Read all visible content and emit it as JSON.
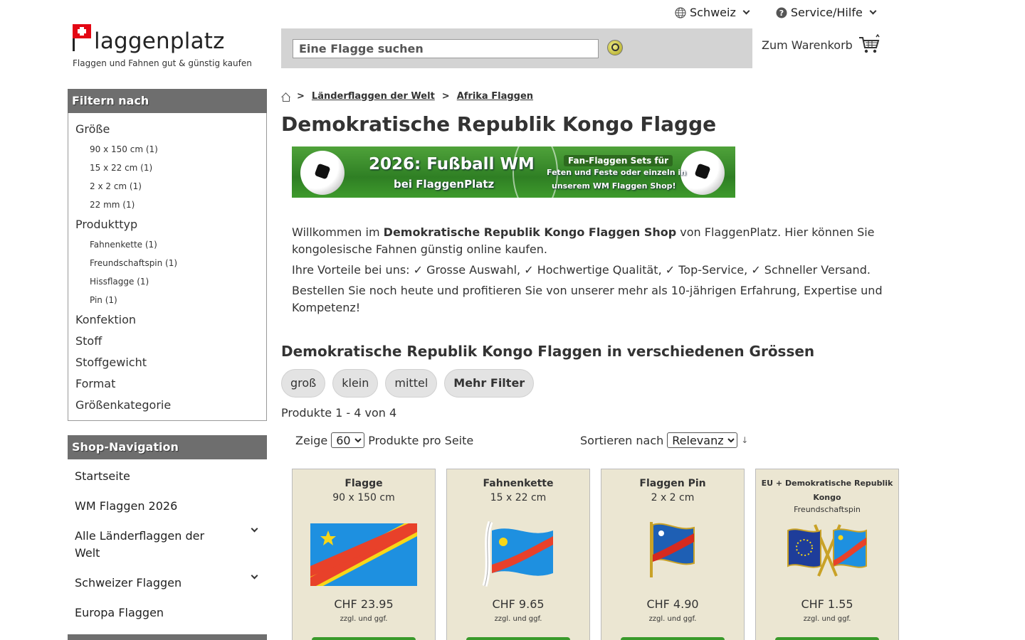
{
  "topbar": {
    "country_label": "Schweiz",
    "service_label": "Service/Hilfe"
  },
  "logo": {
    "name": "laggenplatz",
    "tagline": "Flaggen und Fahnen gut & günstig kaufen"
  },
  "search": {
    "placeholder": "Eine Flagge suchen"
  },
  "cart": {
    "label": "Zum Warenkorb"
  },
  "filter": {
    "heading": "Filtern nach",
    "groups": [
      {
        "label": "Größe",
        "options": [
          "90 x 150 cm (1)",
          "15 x 22 cm (1)",
          "2 x 2 cm (1)",
          "22 mm (1)"
        ]
      },
      {
        "label": "Produkttyp",
        "options": [
          "Fahnenkette (1)",
          "Freundschaftspin (1)",
          "Hissflagge (1)",
          "Pin (1)"
        ]
      },
      {
        "label": "Konfektion"
      },
      {
        "label": "Stoff"
      },
      {
        "label": "Stoffgewicht"
      },
      {
        "label": "Format"
      },
      {
        "label": "Größenkategorie"
      }
    ]
  },
  "shopnav": {
    "heading": "Shop-Navigation",
    "items": [
      {
        "label": "Startseite"
      },
      {
        "label": "WM Flaggen 2026"
      },
      {
        "label": "Alle Länderflaggen der Welt"
      },
      {
        "label": "Schweizer Flaggen"
      },
      {
        "label": "Europa Flaggen"
      }
    ]
  },
  "breadcrumb": {
    "items": [
      "Länderflaggen der Welt",
      "Afrika Flaggen"
    ]
  },
  "page": {
    "title": "Demokratische Republik Kongo Flagge"
  },
  "banner": {
    "headline": "2026: Fußball WM",
    "subline": "bei FlaggenPlatz",
    "tag": "Fan-Flaggen Sets für",
    "line2": "Feten und Feste oder einzeln in",
    "line3": "unserem WM Flaggen Shop!"
  },
  "intro": {
    "p1_pre": "Willkommen im ",
    "p1_bold": "Demokratische Republik Kongo Flaggen Shop",
    "p1_post": " von FlaggenPlatz. Hier können Sie kongolesische Fahnen günstig online kaufen.",
    "p2": "Ihre Vorteile bei uns: ✓ Grosse Auswahl, ✓ Hochwertige Qualität, ✓ Top-Service, ✓ Schneller Versand.",
    "p3": "Bestellen Sie noch heute und profitieren Sie von unserer mehr als 10-jährigen Erfahrung, Expertise und Kompetenz!"
  },
  "listing": {
    "section_title": "Demokratische Republik Kongo Flaggen in verschiedenen Grössen",
    "chips": [
      "groß",
      "klein",
      "mittel",
      "Mehr Filter"
    ],
    "count_text": "Produkte 1 - 4 von 4",
    "show_label": "Zeige",
    "per_page_value": "60",
    "per_page_label": "Produkte pro Seite",
    "sort_label": "Sortieren nach",
    "sort_value": "Relevanz",
    "sort_arrow": "↓"
  },
  "products": [
    {
      "type": "Flagge",
      "size": "90 x 150 cm",
      "price": "CHF 23.95",
      "note": "zzgl. und ggf.",
      "kind": "flag"
    },
    {
      "type": "Fahnenkette",
      "size": "15 x 22 cm",
      "price": "CHF 9.65",
      "note": "zzgl. und ggf.",
      "kind": "chain"
    },
    {
      "type": "Flaggen Pin",
      "size": "2 x 2 cm",
      "price": "CHF 4.90",
      "note": "zzgl. und ggf.",
      "kind": "pin"
    },
    {
      "type": "EU + Demokratische Republik Kongo",
      "size": "Freundschaftspin",
      "price": "CHF 1.55",
      "note": "zzgl. und ggf.",
      "kind": "friend"
    }
  ],
  "colors": {
    "drc_blue": "#1e90e0",
    "drc_red": "#e8412a",
    "drc_yellow": "#f7d618",
    "panel_head": "#6e6e6e",
    "card_bg": "#ebe6d2",
    "button_green": "#3a9a2b"
  },
  "icons": {
    "globe": "globe-icon",
    "help": "question-icon",
    "cart": "shopping-cart-icon",
    "home": "home-icon",
    "search": "magnifier-icon"
  }
}
